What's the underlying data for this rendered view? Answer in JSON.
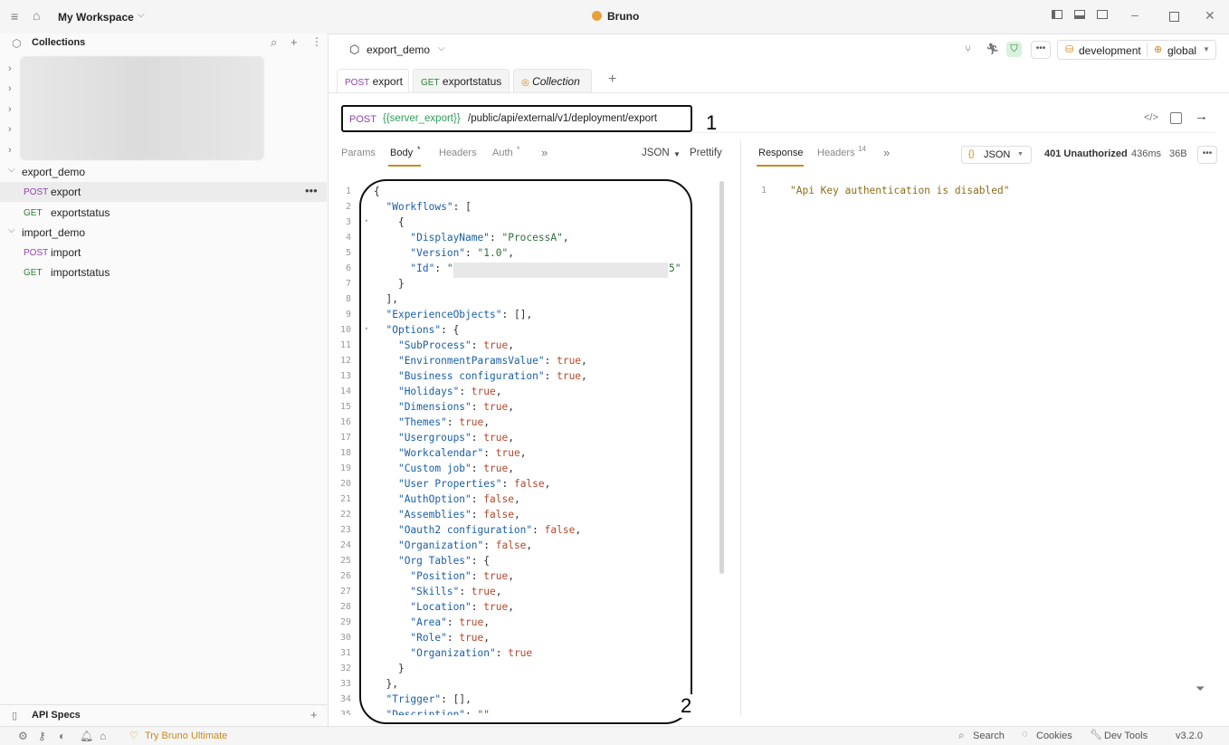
{
  "titlebar": {
    "workspace": "My Workspace",
    "app_title": "Bruno"
  },
  "sidebar": {
    "collections_label": "Collections",
    "folders": [
      {
        "name": "export_demo",
        "items": [
          {
            "method": "POST",
            "name": "export"
          },
          {
            "method": "GET",
            "name": "exportstatus"
          }
        ]
      },
      {
        "name": "import_demo",
        "items": [
          {
            "method": "POST",
            "name": "import"
          },
          {
            "method": "GET",
            "name": "importstatus"
          }
        ]
      }
    ],
    "api_specs_label": "API Specs"
  },
  "collection": {
    "name": "export_demo",
    "env": "development",
    "global": "global"
  },
  "tabs": [
    {
      "method": "POST",
      "label": "export"
    },
    {
      "method": "GET",
      "label": "exportstatus"
    },
    {
      "label": "Collection"
    }
  ],
  "request": {
    "method": "POST",
    "url_var": "{{server_export}}",
    "url_path": "/public/api/external/v1/deployment/export",
    "annotation_1": "1",
    "annotation_2": "2",
    "subtabs": [
      "Params",
      "Body",
      "Headers",
      "Auth"
    ],
    "body_mode": "JSON",
    "prettify": "Prettify"
  },
  "response": {
    "tab_response": "Response",
    "tab_headers": "Headers",
    "headers_count": "14",
    "format": "JSON",
    "status": "401 Unauthorized",
    "time": "436ms",
    "size": "36B",
    "line": "1",
    "body": "\"Api Key authentication is disabled\""
  },
  "status_bar": {
    "try": "Try Bruno Ultimate",
    "search": "Search",
    "cookies": "Cookies",
    "devtools": "Dev Tools",
    "version": "v3.2.0"
  },
  "code_lines": [
    "{",
    "  \"Workflows\": [",
    "    {",
    "      \"DisplayName\": \"ProcessA\",",
    "      \"Version\": \"1.0\",",
    "      \"Id\": \"",
    "    }",
    "  ],",
    "  \"ExperienceObjects\": [],",
    "  \"Options\": {",
    "    \"SubProcess\": true,",
    "    \"EnvironmentParamsValue\": true,",
    "    \"Business configuration\": true,",
    "    \"Holidays\": true,",
    "    \"Dimensions\": true,",
    "    \"Themes\": true,",
    "    \"Usergroups\": true,",
    "    \"Workcalendar\": true,",
    "    \"Custom job\": true,",
    "    \"User Properties\": false,",
    "    \"AuthOption\": false,",
    "    \"Assemblies\": false,",
    "    \"Oauth2 configuration\": false,",
    "    \"Organization\": false,",
    "    \"Org Tables\": {",
    "      \"Position\": true,",
    "      \"Skills\": true,",
    "      \"Location\": true,",
    "      \"Area\": true,",
    "      \"Role\": true,",
    "      \"Organization\": true",
    "    }",
    "  },",
    "  \"Trigger\": [],",
    "  \"Description\": \"\""
  ],
  "id_suffix": "5\""
}
